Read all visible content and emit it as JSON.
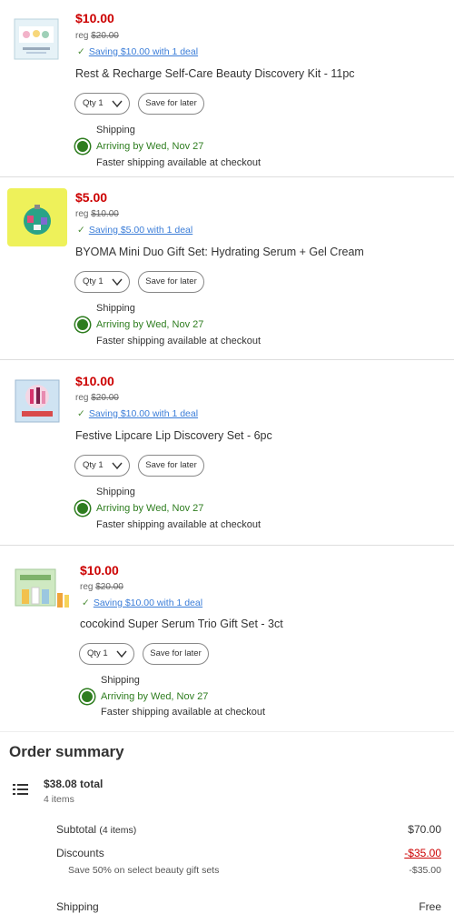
{
  "items": [
    {
      "price": "$10.00",
      "reg_label": "reg",
      "reg_price": "$20.00",
      "saving": "Saving $10.00 with 1 deal",
      "title": "Rest & Recharge Self-Care Beauty Discovery Kit - 11pc",
      "qty_label": "Qty 1",
      "save_later": "Save for later",
      "shipping_label": "Shipping",
      "arriving": "Arriving by Wed, Nov 27",
      "faster": "Faster shipping available at checkout"
    },
    {
      "price": "$5.00",
      "reg_label": "reg",
      "reg_price": "$10.00",
      "saving": "Saving $5.00 with 1 deal",
      "title": "BYOMA Mini Duo Gift Set: Hydrating Serum + Gel Cream",
      "qty_label": "Qty 1",
      "save_later": "Save for later",
      "shipping_label": "Shipping",
      "arriving": "Arriving by Wed, Nov 27",
      "faster": "Faster shipping available at checkout"
    },
    {
      "price": "$10.00",
      "reg_label": "reg",
      "reg_price": "$20.00",
      "saving": "Saving $10.00 with 1 deal",
      "title": "Festive Lipcare Lip Discovery Set - 6pc",
      "qty_label": "Qty 1",
      "save_later": "Save for later",
      "shipping_label": "Shipping",
      "arriving": "Arriving by Wed, Nov 27",
      "faster": "Faster shipping available at checkout"
    },
    {
      "price": "$10.00",
      "reg_label": "reg",
      "reg_price": "$20.00",
      "saving": "Saving $10.00 with 1 deal",
      "title": "cocokind Super Serum Trio Gift Set - 3ct",
      "qty_label": "Qty 1",
      "save_later": "Save for later",
      "shipping_label": "Shipping",
      "arriving": "Arriving by Wed, Nov 27",
      "faster": "Faster shipping available at checkout"
    }
  ],
  "summary": {
    "title": "Order summary",
    "total": "$38.08 total",
    "count": "4 items",
    "subtotal_label": "Subtotal",
    "subtotal_paren": "(4 items)",
    "subtotal_value": "$70.00",
    "discounts_label": "Discounts",
    "discounts_value": "-$35.00",
    "discount_detail_label": "Save 50% on select beauty gift sets",
    "discount_detail_value": "-$35.00",
    "shipping_label": "Shipping",
    "shipping_value": "Free"
  },
  "colors": {
    "price": "#cc0000",
    "link": "#3b7dd8",
    "arriving": "#2e7d1f"
  }
}
